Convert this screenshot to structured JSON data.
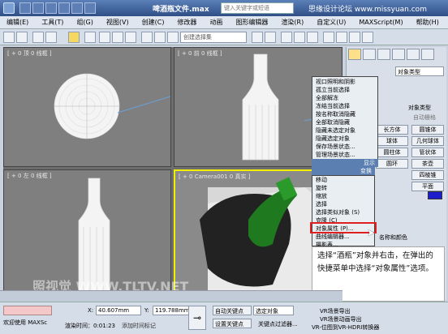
{
  "window": {
    "title": "啤酒瓶文件.max",
    "search_placeholder": "键入关键字或短语",
    "watermark": "思缘设计论坛 www.missyuan.com"
  },
  "menu": [
    "编辑(E)",
    "工具(T)",
    "组(G)",
    "视图(V)",
    "创建(C)",
    "修改器",
    "动画",
    "图形编辑器",
    "渲染(R)",
    "自定义(U)",
    "MAXScript(M)",
    "帮助(H)"
  ],
  "toolbar": {
    "selection_filter": "创建选择集"
  },
  "viewports": {
    "top": "[ + 0 顶 0 线框 ]",
    "front": "[ + 0 前 0 线框 ]",
    "left": "[ + 0 左 0 线框 ]",
    "camera": "[ + 0 Camera001 0 真实 ]"
  },
  "command_panel": {
    "dropdown": "对象类型",
    "header": "对象类型",
    "autogrid": "自动栅格",
    "buttons_left": [
      "长方体",
      "球体",
      "圆柱体",
      "圆环",
      "四棱锥",
      "平面"
    ],
    "buttons_right": [
      "圆锥体",
      "几何球体",
      "管状体",
      "茶壶",
      "",
      ""
    ],
    "name_label": "名称和颜色"
  },
  "quad_menu_top": {
    "items": [
      "视口照明和阴影",
      "孤立当前选择",
      "全部解冻",
      "冻结当前选择",
      "按名称取消隐藏",
      "全部取消隐藏",
      "隐藏未选定对象",
      "隐藏选定对象",
      "保存场景状态...",
      "管理场景状态..."
    ],
    "header": "显示"
  },
  "quad_menu_bottom": {
    "header": "变换",
    "items": [
      "移动",
      "旋转",
      "缩放",
      "选择",
      "选择类似对象 (S)",
      "克隆 (C)",
      "对象属性 (P)...",
      "曲线编辑器...",
      "摄影表..."
    ],
    "highlighted": "对象属性 (P)..."
  },
  "callout": {
    "text": "选择“酒瓶”对象并右击，在弹出的快捷菜单中选择“对象属性”选项。"
  },
  "status": {
    "welcome": "欢迎使用 MAXSc",
    "x_label": "X:",
    "x_value": "40.607mm",
    "y_label": "Y:",
    "y_value": "119.788mm",
    "auto_key": "自动关键点",
    "set_key": "设置关键点",
    "selected": "选定对象",
    "key_filters": "关键点过滤器...",
    "render_time": "渲染时间：0:01:23",
    "add_time": "添加时间标记",
    "vray_menu": [
      "VR场景导出",
      "VR场景动画导出",
      "VR-位图到VR-HDRI转换器"
    ]
  },
  "footer_watermark": "照视觉 WWW.TLTV.NET"
}
